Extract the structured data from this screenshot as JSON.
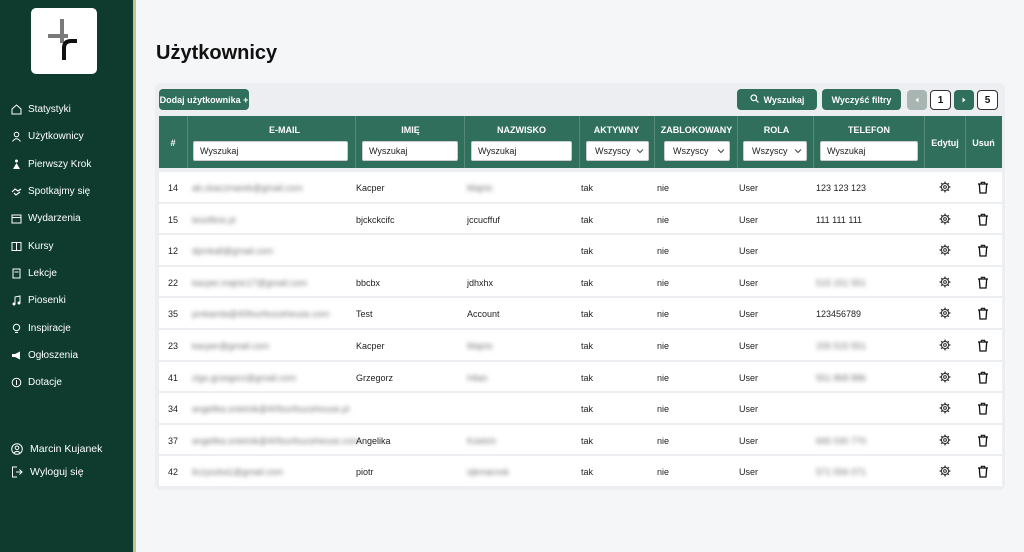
{
  "nav": [
    {
      "label": "Statystyki",
      "icon": "home-icon"
    },
    {
      "label": "Użytkownicy",
      "icon": "user-icon"
    },
    {
      "label": "Pierwszy Krok",
      "icon": "steps-icon"
    },
    {
      "label": "Spotkajmy się",
      "icon": "handshake-icon"
    },
    {
      "label": "Wydarzenia",
      "icon": "calendar-icon"
    },
    {
      "label": "Kursy",
      "icon": "courses-icon"
    },
    {
      "label": "Lekcje",
      "icon": "lesson-icon"
    },
    {
      "label": "Piosenki",
      "icon": "music-icon"
    },
    {
      "label": "Inspiracje",
      "icon": "lightbulb-icon"
    },
    {
      "label": "Ogłoszenia",
      "icon": "megaphone-icon"
    },
    {
      "label": "Dotacje",
      "icon": "coin-icon"
    }
  ],
  "user": {
    "name": "Marcin Kujanek",
    "logout": "Wyloguj się"
  },
  "page": {
    "title": "Użytkownicy"
  },
  "toolbar": {
    "add_label": "Dodaj użytkownika +",
    "search_label": "Wyszukaj",
    "clear_label": "Wyczyść filtry",
    "current_page": "1",
    "total_pages": "5"
  },
  "table": {
    "headers": {
      "num": "#",
      "email": "E-MAIL",
      "first": "IMIĘ",
      "last": "NAZWISKO",
      "active": "AKTYWNY",
      "blocked": "ZABLOKOWANY",
      "role": "ROLA",
      "phone": "TELEFON",
      "edit": "Edytuj",
      "delete": "Usuń"
    },
    "filters": {
      "email_placeholder": "Wyszukaj",
      "first_placeholder": "Wyszukaj",
      "last_placeholder": "Wyszukaj",
      "phone_placeholder": "Wyszukaj",
      "active_value": "Wszyscy",
      "blocked_value": "Wszyscy",
      "role_value": "Wszyscy"
    },
    "rows": [
      {
        "id": "14",
        "email": "ab.ckaczmarek@gmail.com",
        "first": "Kacper",
        "last": "Majnic",
        "active": "tak",
        "blocked": "nie",
        "role": "User",
        "phone": "123 123 123"
      },
      {
        "id": "15",
        "email": "tesoftine.pl",
        "first": "bjckckcifc",
        "last": "jccucffuf",
        "active": "tak",
        "blocked": "nie",
        "role": "User",
        "phone": "111 111 111"
      },
      {
        "id": "12",
        "email": "dpmkall@gmail.com",
        "first": "",
        "last": "",
        "active": "tak",
        "blocked": "nie",
        "role": "User",
        "phone": ""
      },
      {
        "id": "22",
        "email": "kacper.majnic17@gmail.com",
        "first": "bbcbx",
        "last": "jdhxhx",
        "active": "tak",
        "blocked": "nie",
        "role": "User",
        "phone": "515 151 551"
      },
      {
        "id": "35",
        "email": "pmkamla@40fourfouceheuse.com",
        "first": "Test",
        "last": "Account",
        "active": "tak",
        "blocked": "nie",
        "role": "User",
        "phone": "123456789"
      },
      {
        "id": "23",
        "email": "kacper@gmail.com",
        "first": "Kacper",
        "last": "Majnic",
        "active": "tak",
        "blocked": "nie",
        "role": "User",
        "phone": "155 515 551"
      },
      {
        "id": "41",
        "email": "zigo.grzegorz@gmail.com",
        "first": "Grzegorz",
        "last": "Hilan",
        "active": "tak",
        "blocked": "nie",
        "role": "User",
        "phone": "551 868 886"
      },
      {
        "id": "34",
        "email": "angelika.snietnik@40fourfoucehouse.pl",
        "first": "",
        "last": "",
        "active": "tak",
        "blocked": "nie",
        "role": "User",
        "phone": ""
      },
      {
        "id": "37",
        "email": "angelika.snietnik@40fourfouceheuse.com",
        "first": "Angelika",
        "last": "Ksielch",
        "active": "tak",
        "blocked": "nie",
        "role": "User",
        "phone": "665 030 770"
      },
      {
        "id": "42",
        "email": "liczyszka1@gmail.com",
        "first": "piotr",
        "last": "ojkmacvsk",
        "active": "tak",
        "blocked": "nie",
        "role": "User",
        "phone": "571 556 071"
      }
    ]
  },
  "colors": {
    "sidebar": "#0e3b2e",
    "accent": "#2f6f5b",
    "accent_edge": "#c9c196"
  }
}
